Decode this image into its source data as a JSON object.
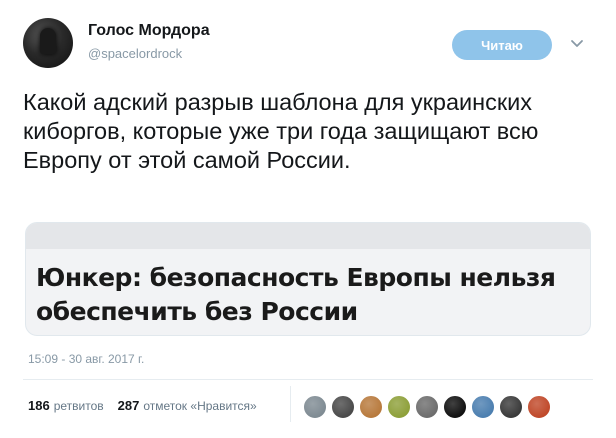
{
  "author": {
    "name": "Голос Мордора",
    "handle": "@spacelordrock"
  },
  "follow_button": {
    "label": "Читаю"
  },
  "tweet": {
    "text": "Какой адский разрыв шаблона для украинских киборгов, которые уже три года защищают всю Европу от этой самой России.",
    "card_headline": "Юнкер: безопасность Европы нельзя обеспечить без России",
    "timestamp": "15:09 - 30 авг. 2017 г."
  },
  "stats": {
    "retweets_count": "186",
    "retweets_label": "ретвитов",
    "likes_count": "287",
    "likes_label": "отметок «Нравится»"
  },
  "liker_avatars": [
    {
      "color": "#7f8b93",
      "icon": "default-avatar-icon"
    },
    {
      "color": "#4a4a4a",
      "icon": "user-photo"
    },
    {
      "color": "#b87a3d",
      "icon": "user-photo"
    },
    {
      "color": "#8ea03a",
      "icon": "user-photo"
    },
    {
      "color": "#6d6d6d",
      "icon": "user-photo"
    },
    {
      "color": "#111111",
      "icon": "user-photo"
    },
    {
      "color": "#4c7fb0",
      "icon": "user-photo"
    },
    {
      "color": "#3a3a3a",
      "icon": "user-photo"
    },
    {
      "color": "#c0492a",
      "icon": "user-photo"
    }
  ]
}
